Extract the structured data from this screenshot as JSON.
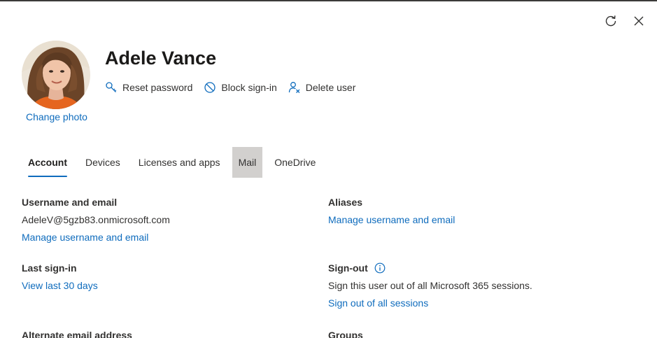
{
  "window": {
    "refresh_icon": "refresh-icon",
    "close_icon": "close-icon"
  },
  "user": {
    "name": "Adele Vance",
    "change_photo": "Change photo"
  },
  "actions": [
    {
      "label": "Reset password",
      "icon": "key-icon"
    },
    {
      "label": "Block sign-in",
      "icon": "block-icon"
    },
    {
      "label": "Delete user",
      "icon": "delete-user-icon"
    }
  ],
  "tabs": [
    {
      "label": "Account",
      "active": true
    },
    {
      "label": "Devices"
    },
    {
      "label": "Licenses and apps"
    },
    {
      "label": "Mail",
      "hovered": true
    },
    {
      "label": "OneDrive"
    }
  ],
  "account": {
    "username": {
      "title": "Username and email",
      "value": "AdeleV@5gzb83.onmicrosoft.com",
      "link": "Manage username and email"
    },
    "aliases": {
      "title": "Aliases",
      "link": "Manage username and email"
    },
    "last_signin": {
      "title": "Last sign-in",
      "link": "View last 30 days"
    },
    "signout": {
      "title": "Sign-out",
      "description": "Sign this user out of all Microsoft 365 sessions.",
      "link": "Sign out of all sessions"
    },
    "alternate_email": {
      "title": "Alternate email address"
    },
    "groups": {
      "title": "Groups"
    }
  },
  "colors": {
    "link": "#0f6cbd",
    "tab_indicator": "#0f6cbd",
    "tab_hover_bg": "#d2d0ce"
  }
}
